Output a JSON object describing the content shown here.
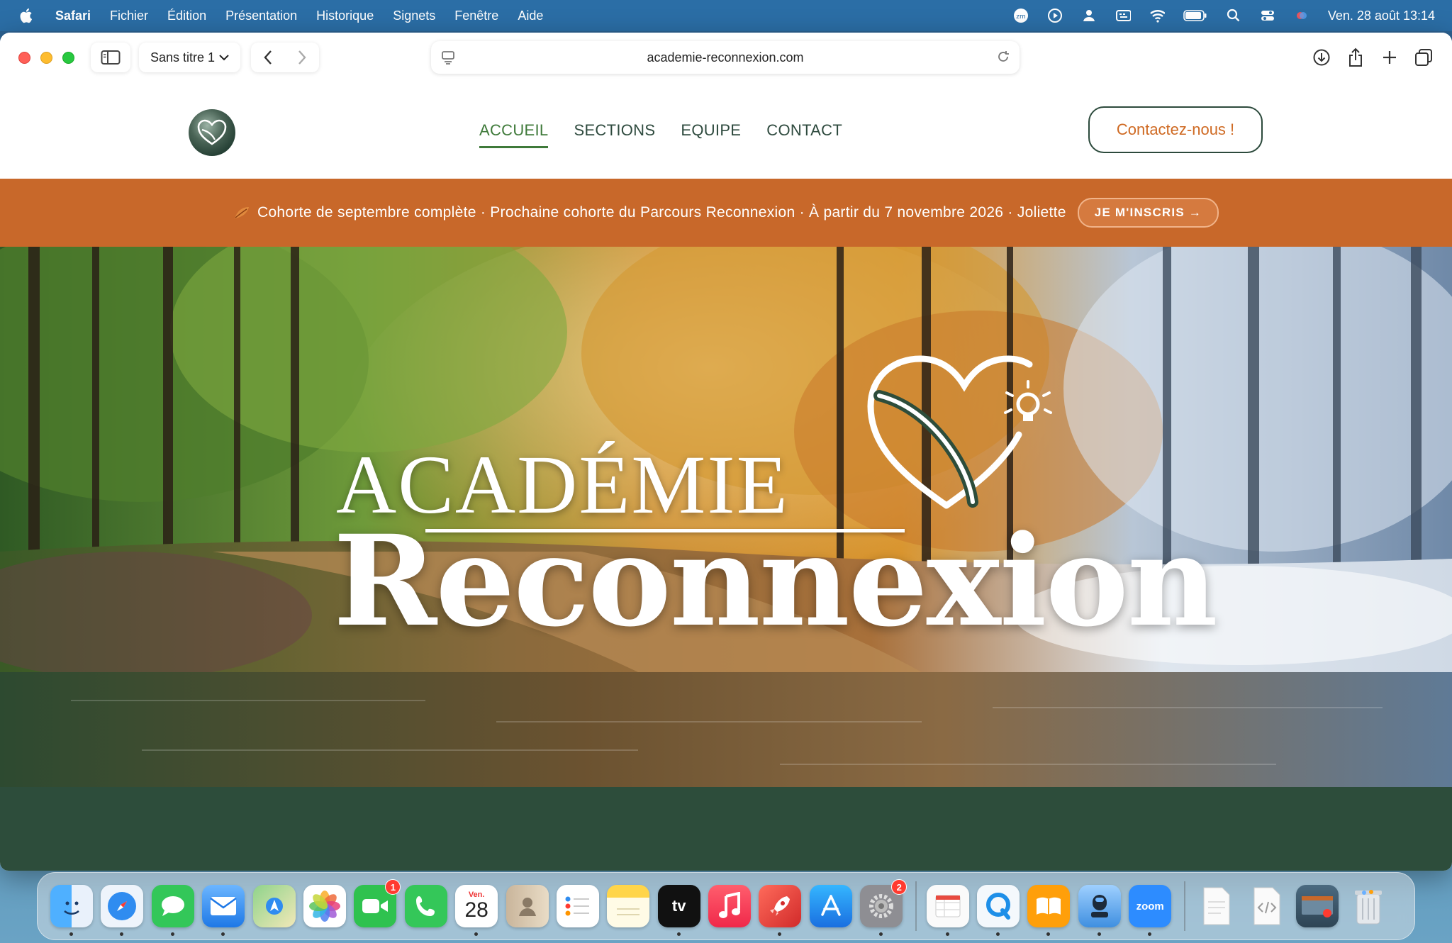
{
  "menubar": {
    "app_name": "Safari",
    "items": [
      "Fichier",
      "Édition",
      "Présentation",
      "Historique",
      "Signets",
      "Fenêtre",
      "Aide"
    ],
    "clock": "Ven. 28 août  13:14",
    "status_icons": [
      "zoom-status-icon",
      "play-icon",
      "user-icon",
      "keyboard-icon",
      "wifi-icon",
      "battery-icon",
      "spotlight-icon",
      "control-center-icon",
      "siri-icon"
    ]
  },
  "browser": {
    "tab_group": "Sans titre 1",
    "url": "academie-reconnexion.com"
  },
  "site": {
    "nav": [
      "ACCUEIL",
      "SECTIONS",
      "EQUIPE",
      "CONTACT"
    ],
    "active_nav": "ACCUEIL",
    "contact_button": "Contactez-nous !",
    "announcement": "Cohorte de septembre complète · Prochaine cohorte du Parcours Reconnexion · À partir du 7 novembre 2026 · Joliette",
    "signup_button": "JE M'INSCRIS →",
    "hero_title_top": "ACADÉMIE",
    "hero_title_main": "Reconnexion"
  },
  "colors": {
    "accent_orange": "#c8682a",
    "nav_green": "#3f7a3a",
    "dark_green": "#2d4d3b",
    "button_text_orange": "#cf6a23"
  },
  "dock": {
    "apps": [
      {
        "name": "finder",
        "color": "#3a8ee6"
      },
      {
        "name": "safari",
        "color": "#2f8cf0"
      },
      {
        "name": "messages",
        "color": "#33c759"
      },
      {
        "name": "mail",
        "color": "#3a90f0"
      },
      {
        "name": "maps",
        "color": "#58b55e"
      },
      {
        "name": "photos",
        "color": "#f4f4f4"
      },
      {
        "name": "facetime",
        "color": "#2fc24f",
        "badge": "1"
      },
      {
        "name": "phone",
        "color": "#34c759"
      },
      {
        "name": "calendar",
        "color": "#ffffff",
        "label_top": "Ven.",
        "label": "28"
      },
      {
        "name": "contacts",
        "color": "#b9a68f"
      },
      {
        "name": "reminders",
        "color": "#ffffff"
      },
      {
        "name": "notes",
        "color": "#fdf6d0"
      },
      {
        "name": "apple-tv",
        "color": "#111111",
        "label": "tv"
      },
      {
        "name": "music",
        "color": "#fa3c55"
      },
      {
        "name": "rocket-typist",
        "color": "#e8423a"
      },
      {
        "name": "app-store",
        "color": "#1d8cf2"
      },
      {
        "name": "system-settings",
        "color": "#8e8e93",
        "badge": "2"
      },
      {
        "name": "numbers",
        "color": "#f5f5f5"
      },
      {
        "name": "quicktime",
        "color": "#1e8fe8"
      },
      {
        "name": "books",
        "color": "#ff9f0a"
      },
      {
        "name": "mic-utility",
        "color": "#5fa5e8"
      },
      {
        "name": "zoom",
        "color": "#2d8cff",
        "label": "zoom"
      },
      {
        "name": "document-file",
        "color": "#f3f3f3"
      },
      {
        "name": "html-file",
        "color": "#f3f3f3"
      },
      {
        "name": "screenshot-folder",
        "color": "#3b5466"
      },
      {
        "name": "trash",
        "color": "#d8dde2"
      }
    ]
  }
}
